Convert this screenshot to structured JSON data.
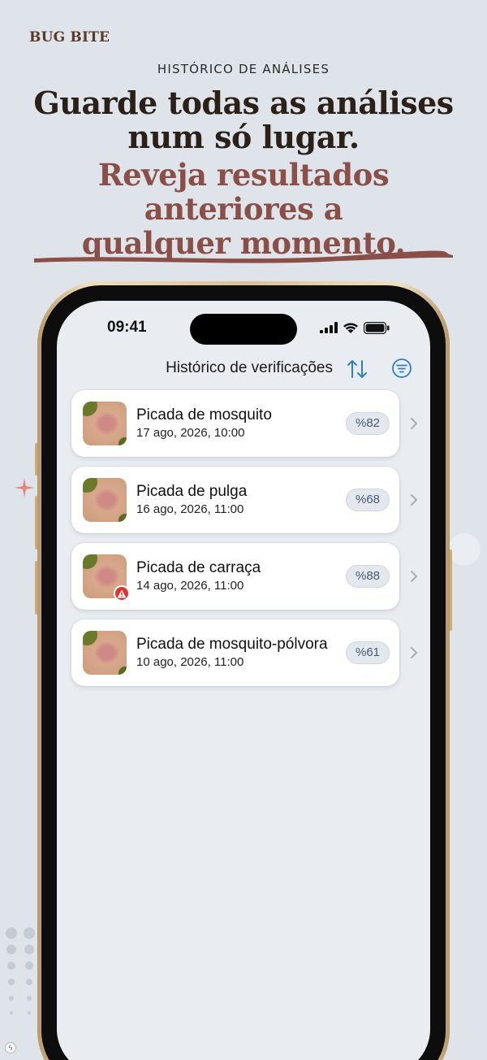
{
  "brand": "BUG BITE",
  "eyebrow": "HISTÓRICO DE ANÁLISES",
  "headline": {
    "line1": "Guarde todas as análises",
    "line2": "num só lugar."
  },
  "subline": {
    "line1": "Reveja resultados",
    "line2": "anteriores a",
    "line3": "qualquer momento."
  },
  "status_bar": {
    "time": "09:41"
  },
  "nav": {
    "title": "Histórico de verificações"
  },
  "records": [
    {
      "title": "Picada de mosquito",
      "date": "17 ago, 2026, 10:00",
      "score": "%82",
      "warning": false
    },
    {
      "title": "Picada de pulga",
      "date": "16 ago, 2026, 11:00",
      "score": "%68",
      "warning": false
    },
    {
      "title": "Picada de carraça",
      "date": "14 ago, 2026, 11:00",
      "score": "%88",
      "warning": true
    },
    {
      "title": "Picada de mosquito-pólvora",
      "date": "10 ago, 2026, 11:00",
      "score": "%61",
      "warning": false
    }
  ],
  "colors": {
    "accent": "#2f7fc4",
    "headline": "#2b2118",
    "subline": "#8a5048",
    "brand": "#5a3a28",
    "warning": "#d33333"
  }
}
